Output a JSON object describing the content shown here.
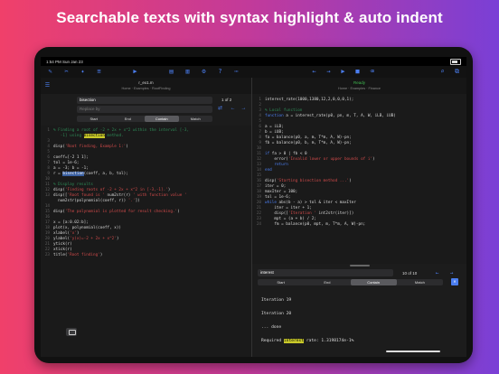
{
  "headline": "Searchable texts with syntax highlight & auto indent",
  "status": {
    "time": "1:54 PM  Sun Jan 23"
  },
  "toolbar_icons": [
    "pencil-icon",
    "scissors-icon",
    "wand-icon",
    "list-icon",
    "play-icon",
    "document-icon",
    "doc-icon",
    "gear-icon",
    "help-icon",
    "ellipsis-icon",
    "back-icon",
    "forward-icon",
    "play-icon",
    "stop-icon",
    "clear-icon",
    "search-icon",
    "window-icon"
  ],
  "left": {
    "title": "r_ex1.m",
    "crumb": "Home · Examples · RootFinding",
    "search": {
      "query": "bisection",
      "replace_placeholder": "Replace by",
      "count": "1 of 2",
      "modes": [
        "Start",
        "End",
        "Contain",
        "Match"
      ],
      "active_mode": 2
    },
    "code": [
      {
        "n": "1",
        "t": [
          {
            "c": "c",
            "v": "% Finding a root of -2 + 2x + x^2 within the interval [-3,"
          }
        ]
      },
      {
        "n": "",
        "t": [
          {
            "c": "c",
            "v": "   -1] using "
          },
          {
            "c": "hl",
            "v": "bisection"
          },
          {
            "c": "c",
            "v": " method."
          }
        ]
      },
      {
        "n": "3",
        "t": []
      },
      {
        "n": "4",
        "t": [
          {
            "c": "",
            "v": "disp("
          },
          {
            "c": "s",
            "v": "'Root finding, Example 1:'"
          },
          {
            "c": "",
            "v": ")"
          }
        ]
      },
      {
        "n": "5",
        "t": []
      },
      {
        "n": "6",
        "t": [
          {
            "c": "",
            "v": "coeff=[-2 1 1];"
          }
        ]
      },
      {
        "n": "7",
        "t": [
          {
            "c": "",
            "v": "tol = 1e-6;"
          }
        ]
      },
      {
        "n": "8",
        "t": [
          {
            "c": "",
            "v": "a = -3; b = -1;"
          }
        ]
      },
      {
        "n": "9",
        "t": [
          {
            "c": "",
            "v": "r = "
          },
          {
            "c": "sel",
            "v": "bisection"
          },
          {
            "c": "",
            "v": "(coeff, a, b, tol);"
          }
        ]
      },
      {
        "n": "10",
        "t": []
      },
      {
        "n": "11",
        "t": [
          {
            "c": "c",
            "v": "% Display results"
          }
        ]
      },
      {
        "n": "12",
        "t": [
          {
            "c": "",
            "v": "disp("
          },
          {
            "c": "s",
            "v": "'Finding roots of -2 + 2x + x^2 in [-3,-1].'"
          },
          {
            "c": "",
            "v": ")"
          }
        ]
      },
      {
        "n": "13",
        "t": [
          {
            "c": "",
            "v": "disp(["
          },
          {
            "c": "s",
            "v": "'Root found is '"
          },
          {
            "c": "",
            "v": " num2str(r) "
          },
          {
            "c": "s",
            "v": "' with function value '"
          }
        ]
      },
      {
        "n": "",
        "t": [
          {
            "c": "",
            "v": "  num2str(polynomial(coeff, r)) "
          },
          {
            "c": "s",
            "v": "'.'"
          },
          {
            "c": "",
            "v": "])"
          }
        ]
      },
      {
        "n": "14",
        "t": []
      },
      {
        "n": "15",
        "t": [
          {
            "c": "",
            "v": "disp("
          },
          {
            "c": "s",
            "v": "'The polynomial is plotted for result checking.'"
          },
          {
            "c": "",
            "v": ")"
          }
        ]
      },
      {
        "n": "16",
        "t": []
      },
      {
        "n": "17",
        "t": [
          {
            "c": "",
            "v": "x = [a:0.02:b];"
          }
        ]
      },
      {
        "n": "18",
        "t": [
          {
            "c": "",
            "v": "plot(x, polynomial(coeff, x))"
          }
        ]
      },
      {
        "n": "19",
        "t": [
          {
            "c": "",
            "v": "xlabel("
          },
          {
            "c": "s",
            "v": "'x'"
          },
          {
            "c": "",
            "v": ")"
          }
        ]
      },
      {
        "n": "20",
        "t": [
          {
            "c": "",
            "v": "ylabel("
          },
          {
            "c": "s",
            "v": "'y(x)=-2 + 2x + x^2'"
          },
          {
            "c": "",
            "v": ")"
          }
        ]
      },
      {
        "n": "21",
        "t": [
          {
            "c": "",
            "v": "ytick(r)"
          }
        ]
      },
      {
        "n": "22",
        "t": [
          {
            "c": "",
            "v": "xtick(r)"
          }
        ]
      },
      {
        "n": "23",
        "t": [
          {
            "c": "",
            "v": "title("
          },
          {
            "c": "s",
            "v": "'Root finding'"
          },
          {
            "c": "",
            "v": ")"
          }
        ]
      }
    ]
  },
  "right": {
    "title": "Ready",
    "crumb": "Home · Examples · Finance",
    "code": [
      {
        "n": "1",
        "t": [
          {
            "c": "",
            "v": "interest_rate(1000,1380,12,2,0,0,0,1);"
          }
        ]
      },
      {
        "n": "2",
        "t": []
      },
      {
        "n": "3",
        "t": [
          {
            "c": "c",
            "v": "% Local function"
          }
        ]
      },
      {
        "n": "4",
        "t": [
          {
            "c": "k",
            "v": "function"
          },
          {
            "c": "",
            "v": " a = interest_rate(p0, pn, m, T, A, W, iLB, iUB)"
          }
        ]
      },
      {
        "n": "5",
        "t": []
      },
      {
        "n": "6",
        "t": [
          {
            "c": "",
            "v": "a = iLB;"
          }
        ]
      },
      {
        "n": "7",
        "t": [
          {
            "c": "",
            "v": "b = iUB;"
          }
        ]
      },
      {
        "n": "8",
        "t": [
          {
            "c": "",
            "v": "fa = balance(p0, a, m, T*m, A, W)-pn;"
          }
        ]
      },
      {
        "n": "9",
        "t": [
          {
            "c": "",
            "v": "fb = balance(p0, b, m, T*m, A, W)-pn;"
          }
        ]
      },
      {
        "n": "10",
        "t": []
      },
      {
        "n": "11",
        "t": [
          {
            "c": "k",
            "v": "if"
          },
          {
            "c": "",
            "v": " fa > 0 | fb < 0"
          }
        ]
      },
      {
        "n": "12",
        "t": [
          {
            "c": "",
            "v": "    error("
          },
          {
            "c": "s",
            "v": "'Invalid lower or upper bounds of i'"
          },
          {
            "c": "",
            "v": ")"
          }
        ]
      },
      {
        "n": "13",
        "t": [
          {
            "c": "",
            "v": "    "
          },
          {
            "c": "k",
            "v": "return"
          }
        ]
      },
      {
        "n": "14",
        "t": [
          {
            "c": "k",
            "v": "end"
          }
        ]
      },
      {
        "n": "15",
        "t": []
      },
      {
        "n": "16",
        "t": [
          {
            "c": "",
            "v": "disp("
          },
          {
            "c": "s",
            "v": "'Starting bisection method ...'"
          },
          {
            "c": "",
            "v": ")"
          }
        ]
      },
      {
        "n": "17",
        "t": [
          {
            "c": "",
            "v": "iter = 0;"
          }
        ]
      },
      {
        "n": "18",
        "t": [
          {
            "c": "",
            "v": "maxIter = 100;"
          }
        ]
      },
      {
        "n": "19",
        "t": [
          {
            "c": "",
            "v": "tol = 1e-6;"
          }
        ]
      },
      {
        "n": "20",
        "t": [
          {
            "c": "k",
            "v": "while"
          },
          {
            "c": "",
            "v": " abs(b - a) > tol & iter < maxIter"
          }
        ]
      },
      {
        "n": "21",
        "t": [
          {
            "c": "",
            "v": "    iter = iter + 1;"
          }
        ]
      },
      {
        "n": "22",
        "t": [
          {
            "c": "",
            "v": "    disp(["
          },
          {
            "c": "s",
            "v": "'Iteration '"
          },
          {
            "c": "",
            "v": " int2str(iter)])"
          }
        ]
      },
      {
        "n": "23",
        "t": [
          {
            "c": "",
            "v": "    mpt = (a + b) / 2;"
          }
        ]
      },
      {
        "n": "24",
        "t": [
          {
            "c": "",
            "v": "    fm = balance(p0, mpt, m, T*m, A, W)-pn;"
          }
        ]
      }
    ],
    "search": {
      "query": "interest",
      "count": "10 of 10",
      "modes": [
        "Start",
        "End",
        "Contain",
        "Match"
      ],
      "active_mode": 2
    },
    "output": [
      "Iteration 19",
      "",
      "Iteration 20",
      "",
      "... done",
      ""
    ],
    "final": {
      "pre": "Required ",
      "hl": "interest",
      "post": " rate: 1.3198174e-1%"
    }
  }
}
